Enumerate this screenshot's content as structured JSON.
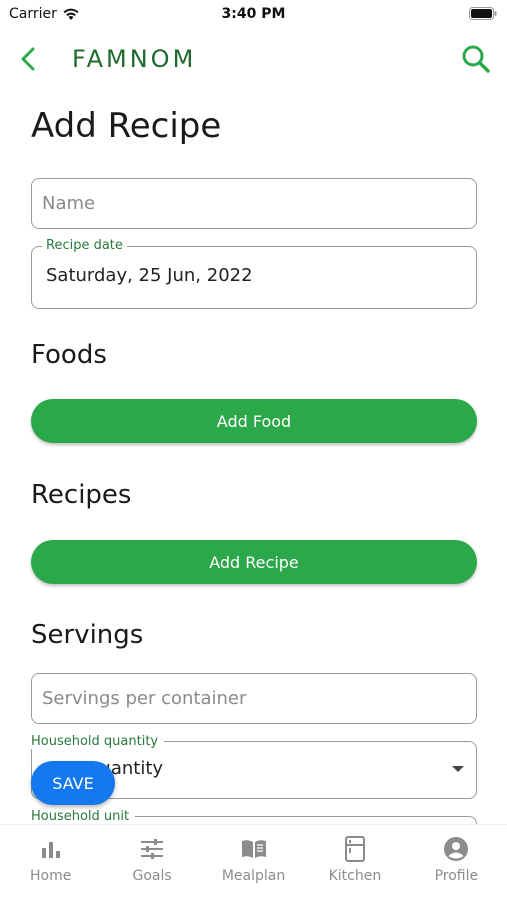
{
  "status_bar": {
    "carrier": "Carrier",
    "time": "3:40 PM"
  },
  "app_bar": {
    "title": "FAMNOM",
    "brand_color": "#1f6b2c",
    "icon_color": "#2aa84a"
  },
  "page": {
    "title": "Add Recipe"
  },
  "form": {
    "name": {
      "placeholder": "Name",
      "value": ""
    },
    "recipe_date": {
      "label": "Recipe date",
      "value": "Saturday, 25 Jun, 2022"
    },
    "foods": {
      "title": "Foods",
      "button_label": "Add Food"
    },
    "recipes": {
      "title": "Recipes",
      "button_label": "Add Recipe"
    },
    "servings": {
      "title": "Servings",
      "servings_per_container": {
        "placeholder": "Servings per container",
        "value": ""
      },
      "household_quantity": {
        "label": "Household quantity",
        "value": "quantity"
      },
      "household_unit": {
        "label": "Household unit"
      }
    }
  },
  "save_button": {
    "label": "SAVE",
    "color": "#1478f0"
  },
  "accent_green": "#2aa84a",
  "bottom_nav": [
    {
      "label": "Home",
      "icon": "bar-chart-icon"
    },
    {
      "label": "Goals",
      "icon": "sliders-icon"
    },
    {
      "label": "Mealplan",
      "icon": "open-book-icon"
    },
    {
      "label": "Kitchen",
      "icon": "fridge-icon"
    },
    {
      "label": "Profile",
      "icon": "account-circle-icon"
    }
  ]
}
